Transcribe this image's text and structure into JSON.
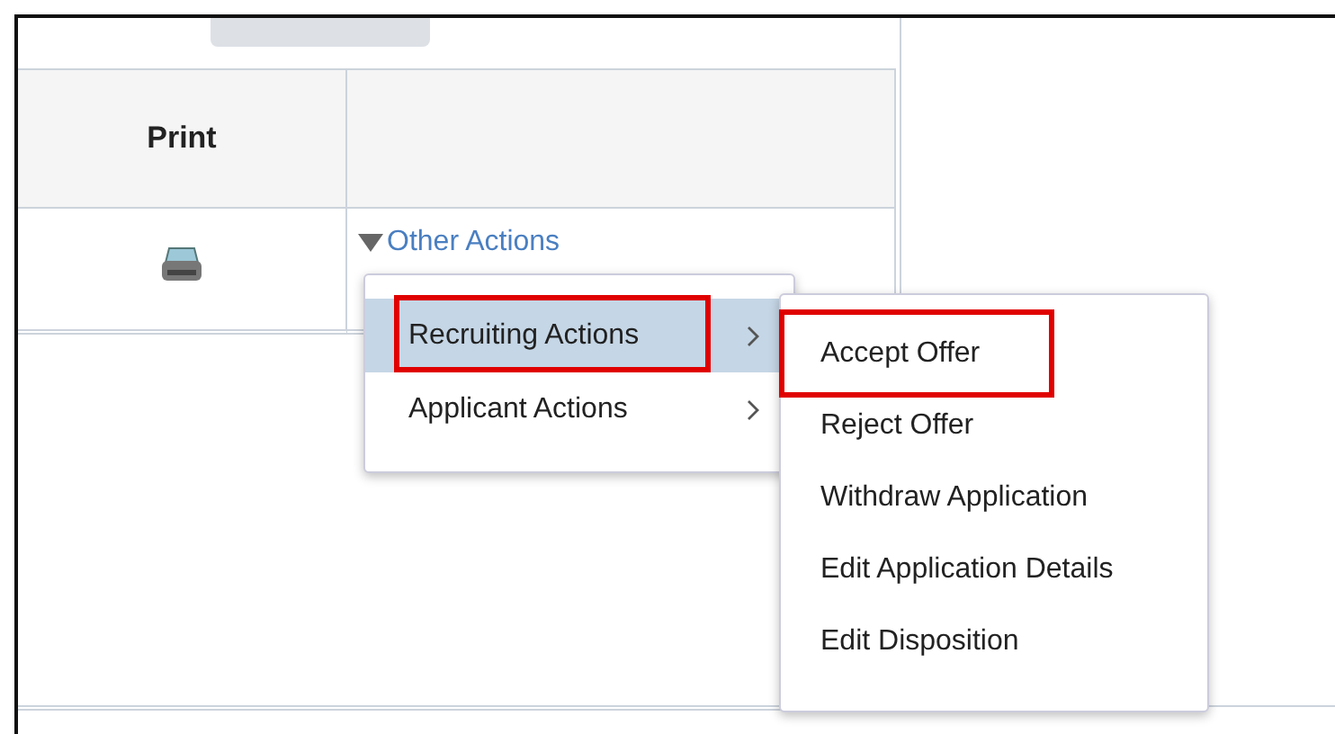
{
  "table": {
    "columns": [
      {
        "label": "Print"
      },
      {}
    ],
    "rows": [
      {
        "print_icon": true,
        "action_link": "Other Actions"
      }
    ]
  },
  "menu": {
    "items": [
      {
        "label": "Recruiting Actions",
        "selected": true,
        "highlighted": true,
        "submenu": true
      },
      {
        "label": "Applicant Actions",
        "selected": false,
        "highlighted": false,
        "submenu": true
      }
    ]
  },
  "submenu": {
    "items": [
      {
        "label": "Accept Offer",
        "highlighted": true
      },
      {
        "label": "Reject Offer",
        "highlighted": false
      },
      {
        "label": "Withdraw Application",
        "highlighted": false
      },
      {
        "label": "Edit Application Details",
        "highlighted": false
      },
      {
        "label": "Edit Disposition",
        "highlighted": false
      }
    ]
  }
}
